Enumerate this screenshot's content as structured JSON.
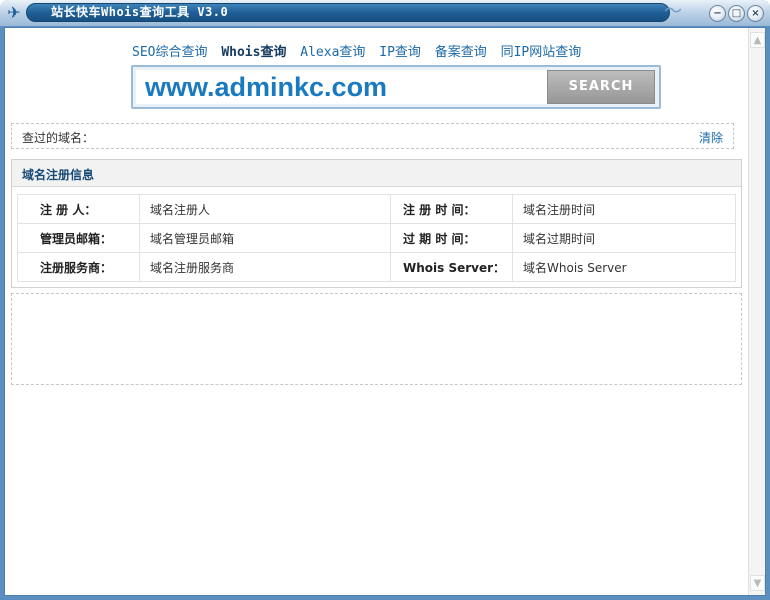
{
  "window": {
    "title": "站长快车Whois查询工具 V3.0",
    "app_icon": "✈",
    "min_glyph": "−",
    "max_glyph": "□",
    "close_glyph": "×"
  },
  "nav": {
    "items": [
      {
        "label": "SEO综合查询",
        "active": false
      },
      {
        "label": "Whois查询",
        "active": true
      },
      {
        "label": "Alexa查询",
        "active": false
      },
      {
        "label": "IP查询",
        "active": false
      },
      {
        "label": "备案查询",
        "active": false
      },
      {
        "label": "同IP网站查询",
        "active": false
      }
    ]
  },
  "search": {
    "value": "www.adminkc.com",
    "button_label": "SEARCH"
  },
  "history": {
    "label": "查过的域名：",
    "clear_label": "清除"
  },
  "panel": {
    "title": "域名注册信息",
    "rows": [
      {
        "label1": "注  册  人：",
        "value1": "域名注册人",
        "label2": "注 册 时 间：",
        "value2": "域名注册时间"
      },
      {
        "label1": "管理员邮箱：",
        "value1": "域名管理员邮箱",
        "label2": "过 期 时 间：",
        "value2": "域名过期时间"
      },
      {
        "label1": "注册服务商：",
        "value1": "域名注册服务商",
        "label2": "Whois Server：",
        "value2": "域名Whois Server"
      }
    ]
  },
  "colors": {
    "title_bar": "#1f5f97",
    "link": "#1c6aa8",
    "search_text": "#1a7ac0",
    "search_button": "#a8a8a8",
    "panel_title": "#174a77"
  },
  "icons": {
    "app": "airplane-icon",
    "minimize": "minimize-icon",
    "maximize": "maximize-icon",
    "close": "close-icon",
    "scroll_up": "scroll-up-icon",
    "scroll_down": "scroll-down-icon"
  }
}
